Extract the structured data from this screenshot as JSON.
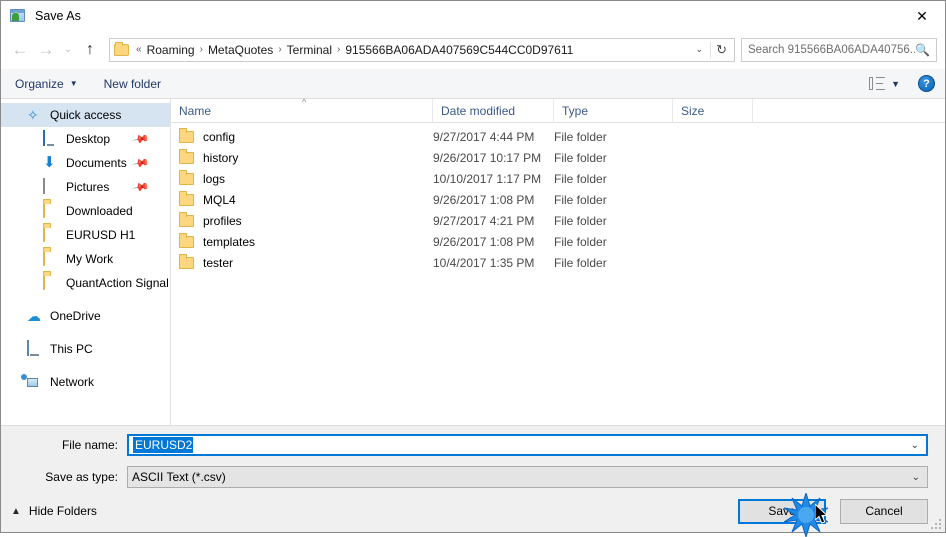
{
  "window": {
    "title": "Save As",
    "icon": "metatrader-icon",
    "close_label": "✕"
  },
  "nav": {
    "back_icon": "←",
    "forward_icon": "→",
    "recent_icon": "⌄",
    "up_icon": "↑",
    "breadcrumbs": [
      "Roaming",
      "MetaQuotes",
      "Terminal",
      "915566BA06ADA407569C544CC0D97611"
    ],
    "prefix": "«",
    "separator": "›",
    "address_caret": "⌄",
    "refresh_icon": "↻"
  },
  "search": {
    "placeholder": "Search 915566BA06ADA40756...",
    "icon": "search-icon"
  },
  "toolbar": {
    "organize_label": "Organize",
    "organize_caret": "▼",
    "new_folder_label": "New folder",
    "view_caret": "▼",
    "help_label": "?"
  },
  "sidebar": {
    "items": [
      {
        "label": "Quick access",
        "icon": "star-icon",
        "selected": true,
        "pinned": false,
        "indent": false
      },
      {
        "label": "Desktop",
        "icon": "desktop-icon",
        "selected": false,
        "pinned": true,
        "indent": true
      },
      {
        "label": "Documents",
        "icon": "documents-icon",
        "selected": false,
        "pinned": true,
        "indent": true
      },
      {
        "label": "Pictures",
        "icon": "pictures-icon",
        "selected": false,
        "pinned": true,
        "indent": true
      },
      {
        "label": "Downloaded",
        "icon": "folder-icon",
        "selected": false,
        "pinned": false,
        "indent": true
      },
      {
        "label": "EURUSD H1",
        "icon": "folder-icon",
        "selected": false,
        "pinned": false,
        "indent": true
      },
      {
        "label": "My Work",
        "icon": "folder-icon",
        "selected": false,
        "pinned": false,
        "indent": true
      },
      {
        "label": "QuantAction Signal",
        "icon": "folder-icon",
        "selected": false,
        "pinned": false,
        "indent": true
      },
      {
        "label": "OneDrive",
        "icon": "onedrive-icon",
        "selected": false,
        "pinned": false,
        "indent": false
      },
      {
        "label": "This PC",
        "icon": "thispc-icon",
        "selected": false,
        "pinned": false,
        "indent": false
      },
      {
        "label": "Network",
        "icon": "network-icon",
        "selected": false,
        "pinned": false,
        "indent": false
      }
    ],
    "pin_icon": "📌"
  },
  "filelist": {
    "columns": [
      "Name",
      "Date modified",
      "Type",
      "Size"
    ],
    "sort_caret": "^",
    "rows": [
      {
        "name": "config",
        "date": "9/27/2017 4:44 PM",
        "type": "File folder",
        "size": ""
      },
      {
        "name": "history",
        "date": "9/26/2017 10:17 PM",
        "type": "File folder",
        "size": ""
      },
      {
        "name": "logs",
        "date": "10/10/2017 1:17 PM",
        "type": "File folder",
        "size": ""
      },
      {
        "name": "MQL4",
        "date": "9/26/2017 1:08 PM",
        "type": "File folder",
        "size": ""
      },
      {
        "name": "profiles",
        "date": "9/27/2017 4:21 PM",
        "type": "File folder",
        "size": ""
      },
      {
        "name": "templates",
        "date": "9/26/2017 1:08 PM",
        "type": "File folder",
        "size": ""
      },
      {
        "name": "tester",
        "date": "10/4/2017 1:35 PM",
        "type": "File folder",
        "size": ""
      }
    ]
  },
  "form": {
    "filename_label": "File name:",
    "filename_value": "EURUSD2",
    "savetype_label": "Save as type:",
    "savetype_value": "ASCII Text (*.csv)",
    "combo_arrow": "⌄"
  },
  "footer": {
    "hide_folders_label": "Hide Folders",
    "hide_folders_caret": "▲",
    "save_label": "Save",
    "cancel_label": "Cancel"
  },
  "colors": {
    "accent": "#0078d7",
    "selection": "#d6e4f2",
    "folder": "#fcd77f",
    "column_header_text": "#3b5a8c"
  }
}
